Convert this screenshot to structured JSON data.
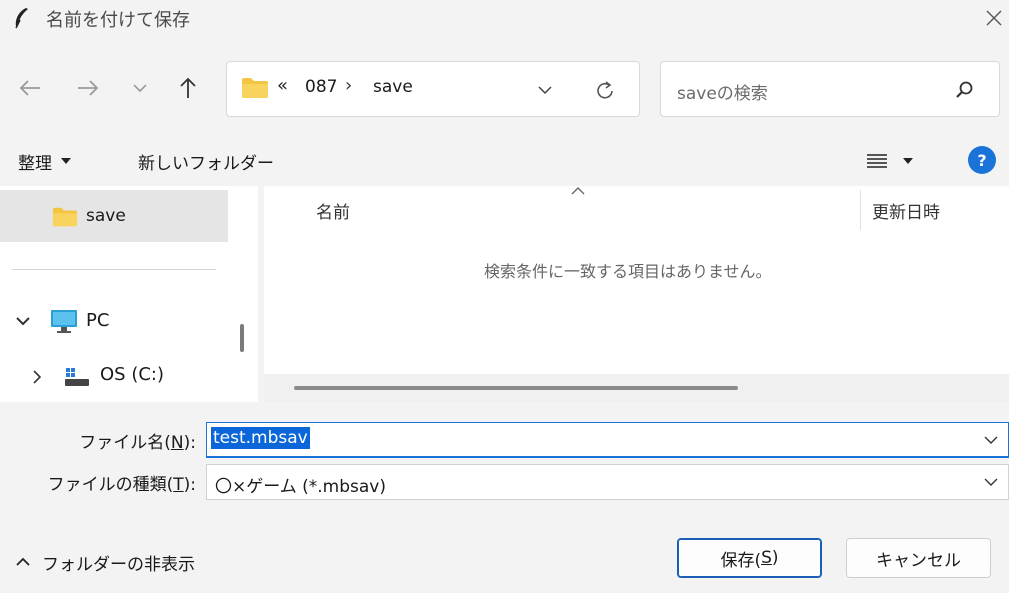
{
  "window": {
    "title": "名前を付けて保存",
    "icon": "feather-icon"
  },
  "address": {
    "overflow": "«",
    "segments": [
      "087",
      "save"
    ],
    "separator": "›"
  },
  "search": {
    "placeholder": "saveの検索"
  },
  "toolbar": {
    "organize_label": "整理",
    "new_folder_label": "新しいフォルダー"
  },
  "nav": {
    "current_folder": "save",
    "pc_label": "PC",
    "drive_label": "OS (C:)"
  },
  "file_list": {
    "columns": [
      "名前",
      "更新日時"
    ],
    "empty_message": "検索条件に一致する項目はありません。"
  },
  "form": {
    "filename_label": "ファイル名(",
    "filename_key": "N",
    "filename_label_end": "):",
    "filename_value": "test.mbsav",
    "filetype_label": "ファイルの種類(",
    "filetype_key": "T",
    "filetype_label_end": "):",
    "filetype_value": "〇×ゲーム (*.mbsav)"
  },
  "footer": {
    "hide_folders_label": "フォルダーの非表示",
    "save_label": "保存(",
    "save_key": "S",
    "save_label_end": ")",
    "cancel_label": "キャンセル"
  },
  "colors": {
    "accent": "#1a73d9",
    "folder": "#f4c542",
    "selection": "#0a66d9"
  }
}
